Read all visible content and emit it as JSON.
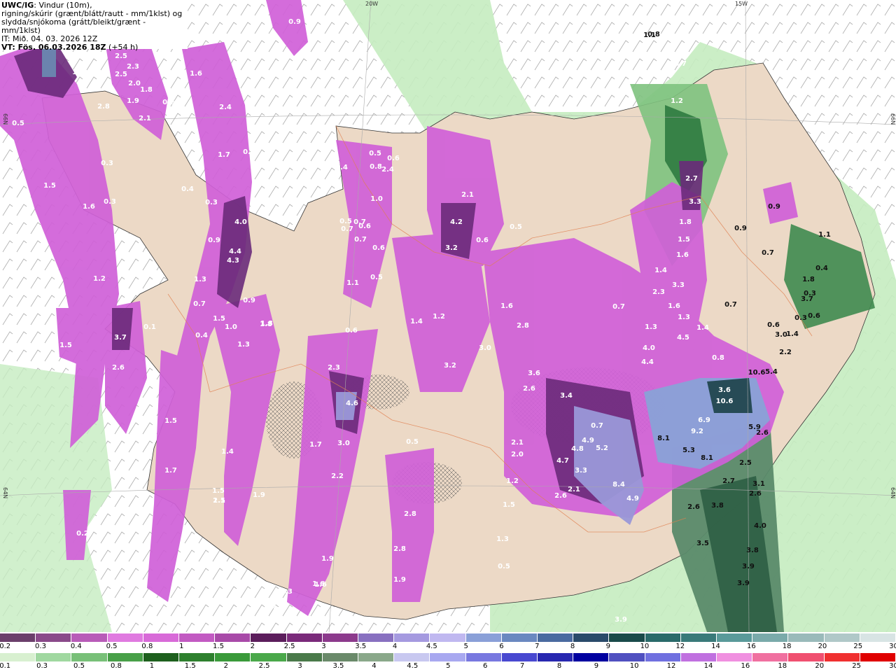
{
  "header": {
    "product": "UWC/IG",
    "line1_rest": ": Vindur (10m),",
    "line2": "rigning/skúrir (grænt/blátt/rautt - mm/1klst) og",
    "line3": "slydda/snjókoma (grátt/bleikt/grænt - mm/1klst)",
    "init": "IT: Mið. 04. 03. 2026 12Z",
    "valid_bold": "VT: Fös. 06.03.2026 18Z",
    "valid_lead": " (+54 h)"
  },
  "graticule": {
    "lon_labels": [
      "20W",
      "15W"
    ],
    "lat_labels": [
      "66N",
      "66N",
      "64N",
      "64N"
    ]
  },
  "map_values": [
    "1.1",
    "2.5",
    "2.3",
    "2.0",
    "1.8",
    "1.9",
    "2.8",
    "2.1",
    "0.5",
    "1.5",
    "1.6",
    "0.3",
    "0.3",
    "2.5",
    "2.4",
    "1.6",
    "0.6",
    "0.6",
    "1.7",
    "0.5",
    "0.4",
    "0.3",
    "4.0",
    "4.4",
    "4.3",
    "1.3",
    "0.7",
    "1.5",
    "1.0",
    "0.9",
    "1.8",
    "1.3",
    "0.4",
    "1.2",
    "1.5",
    "3.7",
    "2.6",
    "0.1",
    "0.9",
    "0.6",
    "0.8",
    "0.5",
    "2.4",
    "0.6",
    "0.5",
    "0.7",
    "1.0",
    "0.7",
    "0.7",
    "0.6",
    "0.5",
    "1.1",
    "0.6",
    "2.3",
    "4.6",
    "3.0",
    "1.7",
    "2.2",
    "1.9",
    "1.6",
    "1.5",
    "1.8",
    "0.5",
    "1.2",
    "1.4",
    "3.2",
    "3.0",
    "2.1",
    "4.2",
    "3.2",
    "0.6",
    "1.6",
    "2.8",
    "3.6",
    "2.6",
    "3.4",
    "0.7",
    "0.5",
    "2.1",
    "2.0",
    "1.2",
    "1.5",
    "1.3",
    "0.5",
    "2.6",
    "4.7",
    "4.8",
    "4.9",
    "5.2",
    "3.3",
    "2.1",
    "8.4",
    "4.9",
    "0.7",
    "1.2",
    "0.8",
    "2.7",
    "3.3",
    "1.8",
    "1.5",
    "1.6",
    "1.4",
    "2.3",
    "3.3",
    "1.6",
    "1.3",
    "1.3",
    "4.0",
    "4.4",
    "4.5",
    "1.4",
    "0.8",
    "3.6",
    "10.6",
    "10.6",
    "5.4",
    "6.9",
    "9.2",
    "8.1",
    "5.3",
    "8.1",
    "5.9",
    "2.6",
    "2.5",
    "2.7",
    "3.1",
    "2.6",
    "2.6",
    "3.8",
    "3.5",
    "4.0",
    "3.8",
    "3.9",
    "3.9",
    "3.9",
    "0.9",
    "1.1",
    "0.7",
    "0.9",
    "0.7",
    "1.1",
    "0.4",
    "1.8",
    "0.3",
    "0.3",
    "0.6",
    "3.7",
    "3.0",
    "2.2",
    "1.4",
    "0.6",
    "0.7",
    "1.4",
    "1.5",
    "1.7",
    "1.4",
    "1.5",
    "2.1",
    "0.2",
    "2.8",
    "2.8",
    "1.9",
    "2.4",
    "1.9",
    "1.6",
    "1.3",
    "1.3",
    "0.9"
  ],
  "legend": {
    "top_labels": [
      "0.2",
      "0.3",
      "0.4",
      "0.5",
      "0.8",
      "1",
      "1.5",
      "2",
      "2.5",
      "3",
      "3.5",
      "4",
      "4.5",
      "5",
      "6",
      "7",
      "8",
      "9",
      "10",
      "12",
      "14",
      "16",
      "18",
      "20",
      "25",
      "30"
    ],
    "bottom_labels": [
      "0.1",
      "0.3",
      "0.5",
      "0.8",
      "1",
      "1.5",
      "2",
      "2.5",
      "3",
      "3.5",
      "4",
      "4.5",
      "5",
      "6",
      "7",
      "8",
      "9",
      "10",
      "12",
      "14",
      "16",
      "18",
      "20",
      "25",
      "30"
    ],
    "top_colors": [
      "#6b3f6b",
      "#8a4a8a",
      "#b85cb8",
      "#e07ae0",
      "#d86ad8",
      "#c25ac2",
      "#a84aa8",
      "#5c1e5c",
      "#7a2a7a",
      "#8c3a8c",
      "#8870c0",
      "#a59ae0",
      "#c0b8f0",
      "#8aa0d8",
      "#6a88c0",
      "#4a6aa0",
      "#2a4a6a",
      "#1a4a4a",
      "#2a6a6a",
      "#3a7a7a",
      "#5a9a9a",
      "#7aaaaa",
      "#9ababa",
      "#b0c8c8",
      "#d8e4e4"
    ],
    "bottom_colors": [
      "#d8f0d0",
      "#a0d8a0",
      "#78c078",
      "#48a048",
      "#1e601e",
      "#2e802e",
      "#3a9a3a",
      "#4aa84a",
      "#4a7a4a",
      "#6a8a6a",
      "#8aa88a",
      "#c8c8f0",
      "#a8a8f0",
      "#7878e0",
      "#4848d0",
      "#2828b0",
      "#0000a0",
      "#5050c0",
      "#7070e0",
      "#c070e0",
      "#f090e0",
      "#f070a0",
      "#f05070",
      "#f03030",
      "#e00000"
    ]
  }
}
